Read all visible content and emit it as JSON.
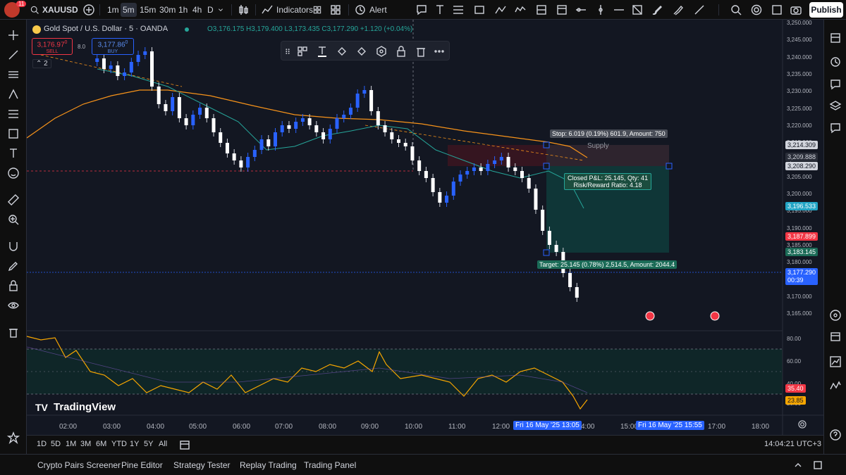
{
  "topbar": {
    "symbol": "XAUUSD",
    "notif_count": "11",
    "intervals": [
      "1m",
      "5m",
      "15m",
      "30m",
      "1h",
      "4h",
      "D"
    ],
    "active_interval": "5m",
    "indicators_label": "Indicators",
    "alert_label": "Alert",
    "publish_label": "Publish"
  },
  "legend": {
    "title": "Gold Spot / U.S. Dollar · 5 · OANDA",
    "ohlc": "O3,176.175 H3,179.400 L3,173.435 C3,177.290 +1.120 (+0.04%)",
    "sell_price": "3,176.97",
    "sell_sup": "0",
    "sell_label": "SELL",
    "spread": "8.0",
    "buy_price": "3,177.86",
    "buy_sup": "0",
    "buy_label": "BUY",
    "indicator_count": "2"
  },
  "position": {
    "stop_label": "Stop: 6.019 (0.19%) 601.9, Amount: 750",
    "closed_label_1": "Closed P&L: 25.145, Qty: 41",
    "closed_label_2": "Risk/Reward Ratio: 4.18",
    "target_label": "Target: 25.145 (0.78%) 2,514.5, Amount: 2044.4",
    "supply_label": "Supply"
  },
  "price_axis": {
    "ticks": [
      "3,250.000",
      "3,245.000",
      "3,240.000",
      "3,235.000",
      "3,230.000",
      "3,225.000",
      "3,220.000",
      "3,215.000",
      "3,210.000",
      "3,205.000",
      "3,200.000",
      "3,195.000",
      "3,190.000",
      "3,185.000",
      "3,180.000",
      "3,175.000",
      "3,170.000",
      "3,165.000"
    ],
    "tag_stop": "3,214.309",
    "tag_ma_orange": "3,209.888",
    "tag_entry": "3,208.290",
    "tag_ma_blue": "3,196.533",
    "tag_red": "3,187.899",
    "tag_target": "3,183.145",
    "tag_last": "3,177.290",
    "tag_countdown": "00:39"
  },
  "rsi_axis": {
    "ticks": [
      "80.00",
      "60.00",
      "40.00",
      "20.00"
    ],
    "tag_rsi": "35.40",
    "tag_ma": "23.85"
  },
  "time_axis": {
    "ticks": [
      "02:00",
      "03:00",
      "04:00",
      "05:00",
      "06:00",
      "07:00",
      "08:00",
      "09:00",
      "10:00",
      "11:00",
      "12:00",
      "15:00",
      "17:00",
      "18:00"
    ],
    "marker_1": "Fri 16 May '25   13:05",
    "marker_2": "Fri 16 May '25   15:55",
    "marker_partial": "4:00"
  },
  "watermark": "TradingView",
  "bottombar": {
    "ranges": [
      "1D",
      "5D",
      "1M",
      "3M",
      "6M",
      "YTD",
      "1Y",
      "5Y",
      "All"
    ],
    "clock": "14:04:21 UTC+3"
  },
  "panelbar": {
    "tabs": [
      "Crypto Pairs Screener",
      "Pine Editor",
      "Strategy Tester",
      "Replay Trading",
      "Trading Panel"
    ]
  },
  "colors": {
    "up": "#2962ff",
    "down": "#ffffff",
    "ma_orange": "#f7931a",
    "ma_teal": "#26a69a",
    "rsi": "#f7a600",
    "target_zone": "#0f3a3a",
    "stop_zone": "#3a1520"
  }
}
